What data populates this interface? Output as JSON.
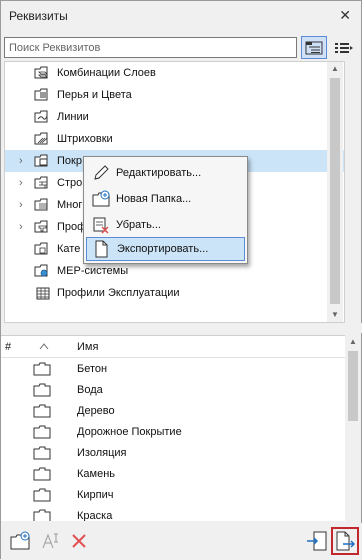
{
  "window": {
    "title": "Реквизиты",
    "close_glyph": "✕"
  },
  "search": {
    "placeholder": "Поиск Реквизитов",
    "value": ""
  },
  "toolbar": {
    "icons": [
      "folder-tree-view-icon",
      "list-view-icon"
    ]
  },
  "tree": {
    "items": [
      {
        "label": "Комбинации Слоев",
        "icon": "layer-combinations-icon",
        "expandable": false
      },
      {
        "label": "Перья и Цвета",
        "icon": "pens-colors-icon",
        "expandable": false
      },
      {
        "label": "Линии",
        "icon": "lines-icon",
        "expandable": false
      },
      {
        "label": "Штриховки",
        "icon": "fills-icon",
        "expandable": false
      },
      {
        "label": "Покр",
        "icon": "surfaces-icon",
        "expandable": true,
        "selected": true
      },
      {
        "label": "Стро",
        "icon": "building-materials-icon",
        "expandable": true
      },
      {
        "label": "Мног",
        "icon": "composites-icon",
        "expandable": true
      },
      {
        "label": "Проф",
        "icon": "profiles-icon",
        "expandable": true
      },
      {
        "label": "Кате",
        "icon": "categories-icon",
        "expandable": false
      },
      {
        "label": "MEP-системы",
        "icon": "mep-systems-icon",
        "expandable": false
      },
      {
        "label": "Профили Эксплуатации",
        "icon": "operation-profiles-icon",
        "expandable": false
      }
    ]
  },
  "context_menu": {
    "items": [
      {
        "label": "Редактировать...",
        "icon": "pencil-icon"
      },
      {
        "label": "Новая Папка...",
        "icon": "new-folder-icon"
      },
      {
        "label": "Убрать...",
        "icon": "remove-icon"
      },
      {
        "label": "Экспортировать...",
        "icon": "export-icon",
        "highlighted": true
      }
    ]
  },
  "list": {
    "headers": {
      "number": "#",
      "name": "Имя"
    },
    "rows": [
      {
        "name": "Бетон"
      },
      {
        "name": "Вода"
      },
      {
        "name": "Дерево"
      },
      {
        "name": "Дорожное Покрытие"
      },
      {
        "name": "Изоляция"
      },
      {
        "name": "Камень"
      },
      {
        "name": "Кирпич"
      },
      {
        "name": "Краска"
      }
    ]
  },
  "bottom_toolbar": {
    "buttons": [
      "new-folder-icon",
      "rename-icon",
      "delete-icon",
      "import-icon",
      "export-icon"
    ],
    "highlighted": "export-icon"
  },
  "colors": {
    "selection": "#cce4f7",
    "accent_border": "#5b8bd6",
    "highlight_red": "#c0282e",
    "delete_red": "#e05050"
  }
}
